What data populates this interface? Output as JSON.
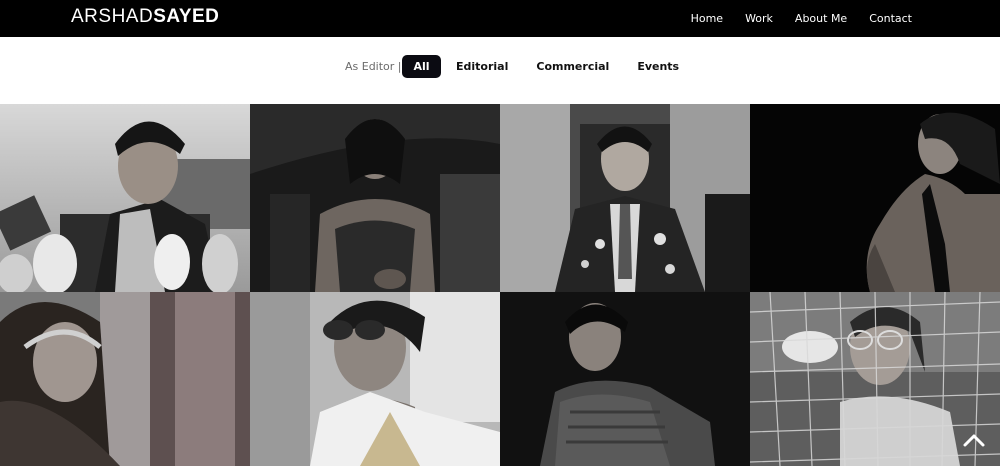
{
  "brand": {
    "light": "ARSHAD",
    "bold": "SAYED"
  },
  "nav": [
    "Home",
    "Work",
    "About Me",
    "Contact"
  ],
  "filter": {
    "label": "As Editor |",
    "options": [
      "All",
      "Editorial",
      "Commercial",
      "Events"
    ],
    "active": "All"
  },
  "gallery": {
    "columns": 4,
    "rows": 2,
    "tiles": 8
  },
  "colors": {
    "header_bg": "#000000",
    "active_pill": "#0b0b12",
    "text_dark": "#111111"
  },
  "icons": {
    "scroll_top": "chevron-up-icon"
  }
}
